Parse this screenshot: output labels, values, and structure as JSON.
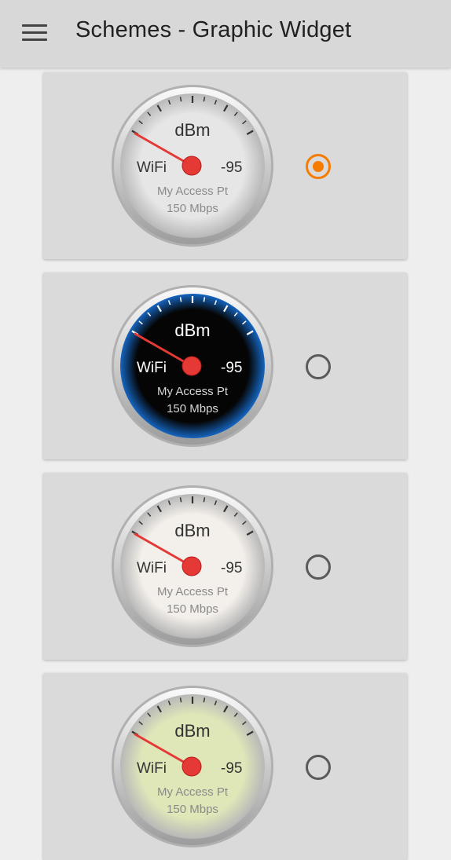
{
  "appbar": {
    "title": "Schemes - Graphic Widget",
    "menu_icon": "hamburger-menu-icon"
  },
  "schemes": [
    {
      "unit": "dBm",
      "network": "WiFi",
      "value": "-95",
      "ssid": "My Access Pt",
      "speed": "150 Mbps",
      "selected": true,
      "face_color": "#e6e6e6",
      "bezel": "silver",
      "text_color": "#333333",
      "sub_color": "#8a8a8a",
      "tick_color": "#333333"
    },
    {
      "unit": "dBm",
      "network": "WiFi",
      "value": "-95",
      "ssid": "My Access Pt",
      "speed": "150 Mbps",
      "selected": false,
      "face_color": "#050505",
      "bezel": "blue",
      "text_color": "#ffffff",
      "sub_color": "#d6d6d6",
      "tick_color": "#ffffff"
    },
    {
      "unit": "dBm",
      "network": "WiFi",
      "value": "-95",
      "ssid": "My Access Pt",
      "speed": "150 Mbps",
      "selected": false,
      "face_color": "#f3efea",
      "bezel": "silver",
      "text_color": "#333333",
      "sub_color": "#8a8a8a",
      "tick_color": "#333333"
    },
    {
      "unit": "dBm",
      "network": "WiFi",
      "value": "-95",
      "ssid": "My Access Pt",
      "speed": "150 Mbps",
      "selected": false,
      "face_color": "#dfe6b8",
      "bezel": "silver",
      "text_color": "#333333",
      "sub_color": "#8a8a8a",
      "tick_color": "#333333"
    }
  ],
  "colors": {
    "accent": "#f57c00",
    "needle": "#e53935"
  }
}
